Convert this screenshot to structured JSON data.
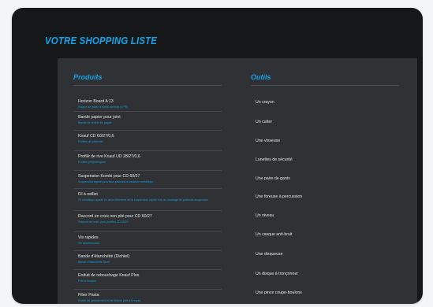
{
  "page": {
    "title": "VOTRE SHOPPING LISTE"
  },
  "columns": {
    "products": "Produits",
    "tools": "Outils"
  },
  "products": [
    {
      "name": "Horizon Board A 13",
      "desc": "Plaque de plâtre à bords amincis (x PE)"
    },
    {
      "name": "Bande papier pour joint",
      "desc": "Bande de renfort en papier"
    },
    {
      "name": "Knauf CD 60/27/0,6",
      "desc": "Profilés de plafonds"
    },
    {
      "name": "Profilé de rive Knauf UD 28/27/0,6",
      "desc": "Profilés périphériques"
    },
    {
      "name": "Suspension Kombi pour CD 60/27",
      "desc": "Suspension rapide pour faux plafonds à ossature métallique"
    },
    {
      "name": "Fil à oeillet",
      "desc": "Fil métallique ajusté en deux éléments de la suspension rapide lors du montage de plafonds suspendus"
    },
    {
      "name": "Raccord en croix non plié pour CD 60/27",
      "desc": "Raccord en croix pour profilés CD 60/27"
    },
    {
      "name": "Vis rapides",
      "desc": "Vis autoforeuses"
    },
    {
      "name": "Bande d’étanchéité (Dichtel)",
      "desc": "Bande d’étanchéité Dicht"
    },
    {
      "name": "Enduit de rebouchage Knauf Plus",
      "desc": "Prêt à l’emploi"
    },
    {
      "name": "Fiber Pasta",
      "desc": "Enduit de jointoiement et de finition prêt à l’emploi"
    }
  ],
  "tools": [
    "Un crayon",
    "Un cutter",
    "Une visseuse",
    "Lunettes de sécurité",
    "Une paire de gants",
    "Une foreuse à percussion",
    "Un niveau",
    "Un casque anti-bruit",
    "Une disqueuse",
    "Un disque à tronçonner",
    "Une pince coupe-boulons"
  ]
}
